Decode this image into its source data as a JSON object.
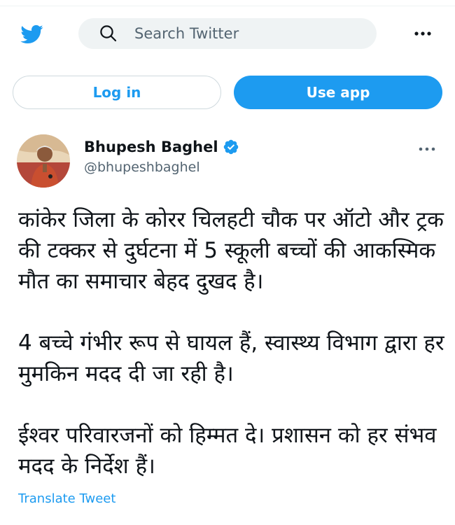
{
  "header": {
    "search_placeholder": "Search Twitter",
    "logo_icon": "twitter-bird-icon",
    "more_icon": "more-dots-icon"
  },
  "actions": {
    "login_label": "Log in",
    "use_app_label": "Use app"
  },
  "tweet": {
    "author_name": "Bhupesh Baghel",
    "author_handle": "@bhupeshbaghel",
    "verified_icon": "verified-badge-icon",
    "paragraphs": [
      "कांकेर जिला के कोरर चिलहटी चौक पर ऑटो और ट्रक की टक्कर से दुर्घटना में 5 स्कूली बच्चों की आकस्मिक मौत का समाचार बेहद दुखद है।",
      "4 बच्चे गंभीर रूप से घायल हैं, स्वास्थ्य विभाग द्वारा हर मुमकिन मदद दी जा रही है।",
      "ईश्वर परिवारजनों को हिम्मत दे। प्रशासन को हर संभव मदद के निर्देश हैं।"
    ],
    "translate_label": "Translate Tweet"
  },
  "colors": {
    "brand_blue": "#1d9bf0",
    "text_primary": "#0f1419",
    "text_secondary": "#536471",
    "search_bg": "#eff3f4"
  }
}
